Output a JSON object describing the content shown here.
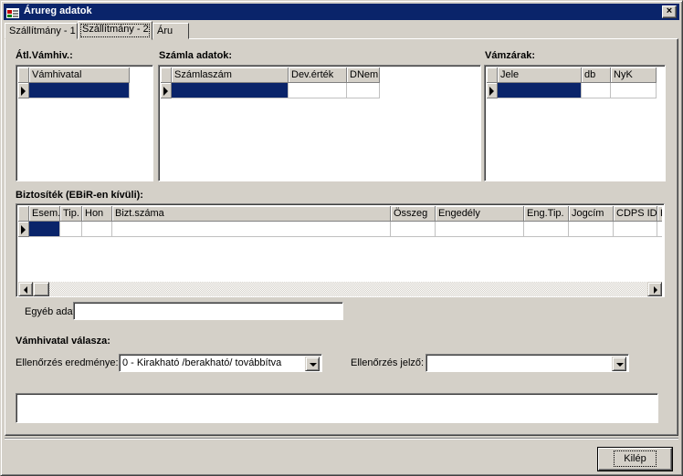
{
  "window": {
    "title": "Árureg adatok",
    "close_glyph": "×",
    "icon": "app-window-icon"
  },
  "tabs": [
    {
      "label": "Szállítmány - 1",
      "active": false
    },
    {
      "label": "Szállítmány - 2",
      "active": true
    },
    {
      "label": "Áru",
      "active": false
    }
  ],
  "atl_vamhiv": {
    "title": "Átl.Vámhiv.:",
    "columns": [
      "Vámhivatal"
    ]
  },
  "szamla": {
    "title": "Számla adatok:",
    "columns": [
      "Számlaszám",
      "Dev.érték",
      "DNem"
    ]
  },
  "vamzarak": {
    "title": "Vámzárak:",
    "columns": [
      "Jele",
      "db",
      "NyK"
    ]
  },
  "biztositek": {
    "title": "Biztosíték (EBiR-en kívüli):",
    "columns": [
      "Esem.",
      "Tip.",
      "Hon",
      "Bizt.száma",
      "Összeg",
      "Engedély",
      "Eng.Tip.",
      "Jogcím",
      "CDPS ID",
      "H"
    ]
  },
  "egyeb": {
    "label": "Egyéb adat:",
    "value": ""
  },
  "vamhivatal_valasza": {
    "title": "Vámhivatal válasza:",
    "ellenorzes_eredmenye_label": "Ellenőrzés eredménye:",
    "ellenorzes_eredmenye_value": "0 - Kirakható /berakható/ továbbítva",
    "ellenorzes_jelzo_label": "Ellenőrzés jelző:",
    "ellenorzes_jelzo_value": ""
  },
  "memo": {
    "value": ""
  },
  "footer": {
    "exit_label": "Kilép"
  },
  "colors": {
    "selection": "#0a246a",
    "titlebar": "#0a246a",
    "face": "#d4d0c8"
  }
}
